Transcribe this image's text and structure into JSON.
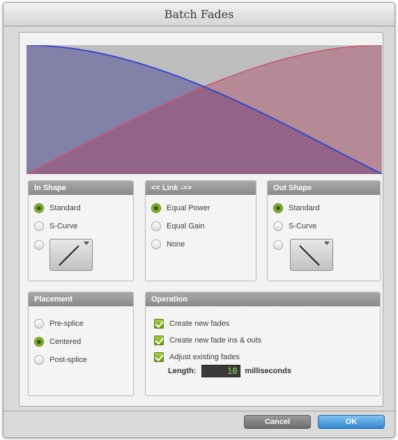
{
  "window": {
    "title": "Batch Fades"
  },
  "in_shape": {
    "header": "In Shape",
    "options": [
      "Standard",
      "S-Curve"
    ],
    "selected": "Standard"
  },
  "link": {
    "header": "<< Link ->>",
    "options": [
      "Equal Power",
      "Equal Gain",
      "None"
    ],
    "selected": "Equal Power"
  },
  "out_shape": {
    "header": "Out Shape",
    "options": [
      "Standard",
      "S-Curve"
    ],
    "selected": "Standard"
  },
  "placement": {
    "header": "Placement",
    "options": [
      "Pre-splice",
      "Centered",
      "Post-splice"
    ],
    "selected": "Centered"
  },
  "operation": {
    "header": "Operation",
    "checkboxes": [
      {
        "label": "Create new fades",
        "checked": true
      },
      {
        "label": "Create new fade ins & outs",
        "checked": true
      },
      {
        "label": "Adjust existing fades",
        "checked": true
      }
    ],
    "length_label": "Length:",
    "length_value": "10",
    "length_unit": "milliseconds"
  },
  "buttons": {
    "cancel": "Cancel",
    "ok": "OK"
  },
  "colors": {
    "fade_in_curve": "#d05070",
    "fade_out_curve": "#2d3fd6",
    "accent_green": "#8ab82a",
    "ok_blue": "#3b8fd6"
  }
}
